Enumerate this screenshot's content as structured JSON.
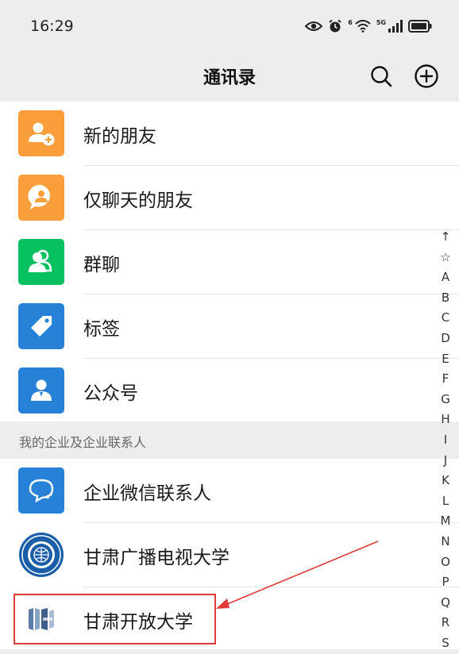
{
  "status_bar": {
    "time": "16:29",
    "network_label": "5G",
    "wifi_label": "6"
  },
  "nav": {
    "title": "通讯录",
    "search_icon": "search-icon",
    "add_icon": "plus-circle-icon"
  },
  "features": [
    {
      "label": "新的朋友",
      "icon": "add-friend-icon",
      "color": "#fa9d3b"
    },
    {
      "label": "仅聊天的朋友",
      "icon": "chat-only-icon",
      "color": "#fa9d3b"
    },
    {
      "label": "群聊",
      "icon": "group-chat-icon",
      "color": "#07c160"
    },
    {
      "label": "标签",
      "icon": "tag-icon",
      "color": "#2782d7"
    },
    {
      "label": "公众号",
      "icon": "official-account-icon",
      "color": "#2782d7"
    }
  ],
  "section": {
    "title": "我的企业及企业联系人"
  },
  "contacts": [
    {
      "label": "企业微信联系人",
      "icon": "wecom-icon",
      "color": "#2782d7"
    },
    {
      "label": "甘肃广播电视大学",
      "icon": "university-logo-icon"
    },
    {
      "label": "甘肃开放大学",
      "icon": "open-university-logo-icon",
      "logo_text": "甘肃开放大学"
    }
  ],
  "index": [
    "↑",
    "☆",
    "A",
    "B",
    "C",
    "D",
    "E",
    "F",
    "G",
    "H",
    "I",
    "J",
    "K",
    "L",
    "M",
    "N",
    "O",
    "P",
    "Q",
    "R",
    "S"
  ],
  "annotation": {
    "color": "#e13a3a"
  }
}
